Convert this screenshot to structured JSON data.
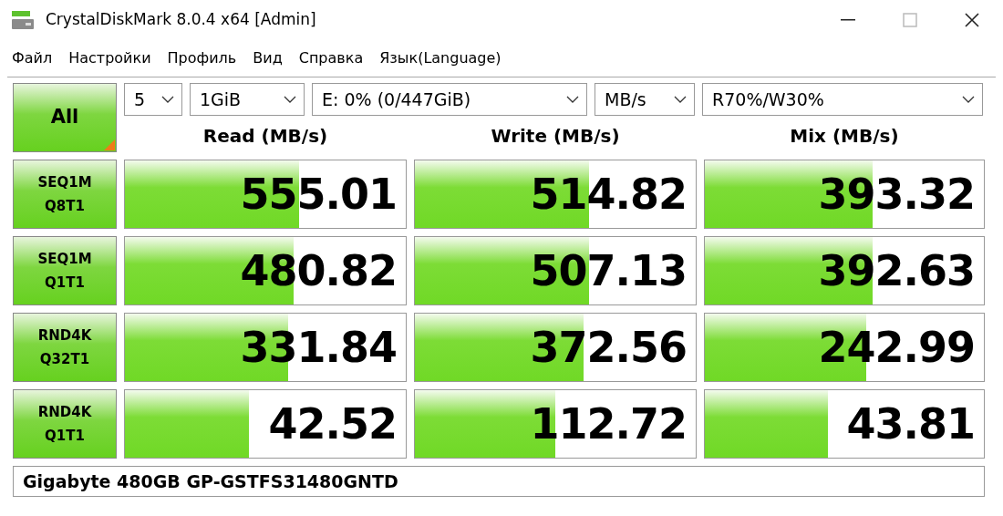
{
  "window": {
    "title": "CrystalDiskMark 8.0.4 x64 [Admin]"
  },
  "menu": [
    "Файл",
    "Настройки",
    "Профиль",
    "Вид",
    "Справка",
    "Язык(Language)"
  ],
  "all_button": "All",
  "settings": [
    {
      "value": "5"
    },
    {
      "value": "1GiB"
    },
    {
      "value": "E: 0% (0/447GiB)"
    },
    {
      "value": "MB/s"
    },
    {
      "value": "R70%/W30%"
    }
  ],
  "columns": [
    "Read (MB/s)",
    "Write (MB/s)",
    "Mix (MB/s)"
  ],
  "rows": [
    {
      "test": [
        "SEQ1M",
        "Q8T1"
      ],
      "results": [
        {
          "value": "555.01",
          "level": 0.62
        },
        {
          "value": "514.82",
          "level": 0.62
        },
        {
          "value": "393.32",
          "level": 0.6
        }
      ]
    },
    {
      "test": [
        "SEQ1M",
        "Q1T1"
      ],
      "results": [
        {
          "value": "480.82",
          "level": 0.6
        },
        {
          "value": "507.13",
          "level": 0.62
        },
        {
          "value": "392.63",
          "level": 0.6
        }
      ]
    },
    {
      "test": [
        "RND4K",
        "Q32T1"
      ],
      "results": [
        {
          "value": "331.84",
          "level": 0.58
        },
        {
          "value": "372.56",
          "level": 0.6
        },
        {
          "value": "242.99",
          "level": 0.58
        }
      ]
    },
    {
      "test": [
        "RND4K",
        "Q1T1"
      ],
      "results": [
        {
          "value": "42.52",
          "level": 0.44
        },
        {
          "value": "112.72",
          "level": 0.5
        },
        {
          "value": "43.81",
          "level": 0.44
        }
      ]
    }
  ],
  "comment": "Gigabyte 480GB GP-GSTFS31480GNTD"
}
